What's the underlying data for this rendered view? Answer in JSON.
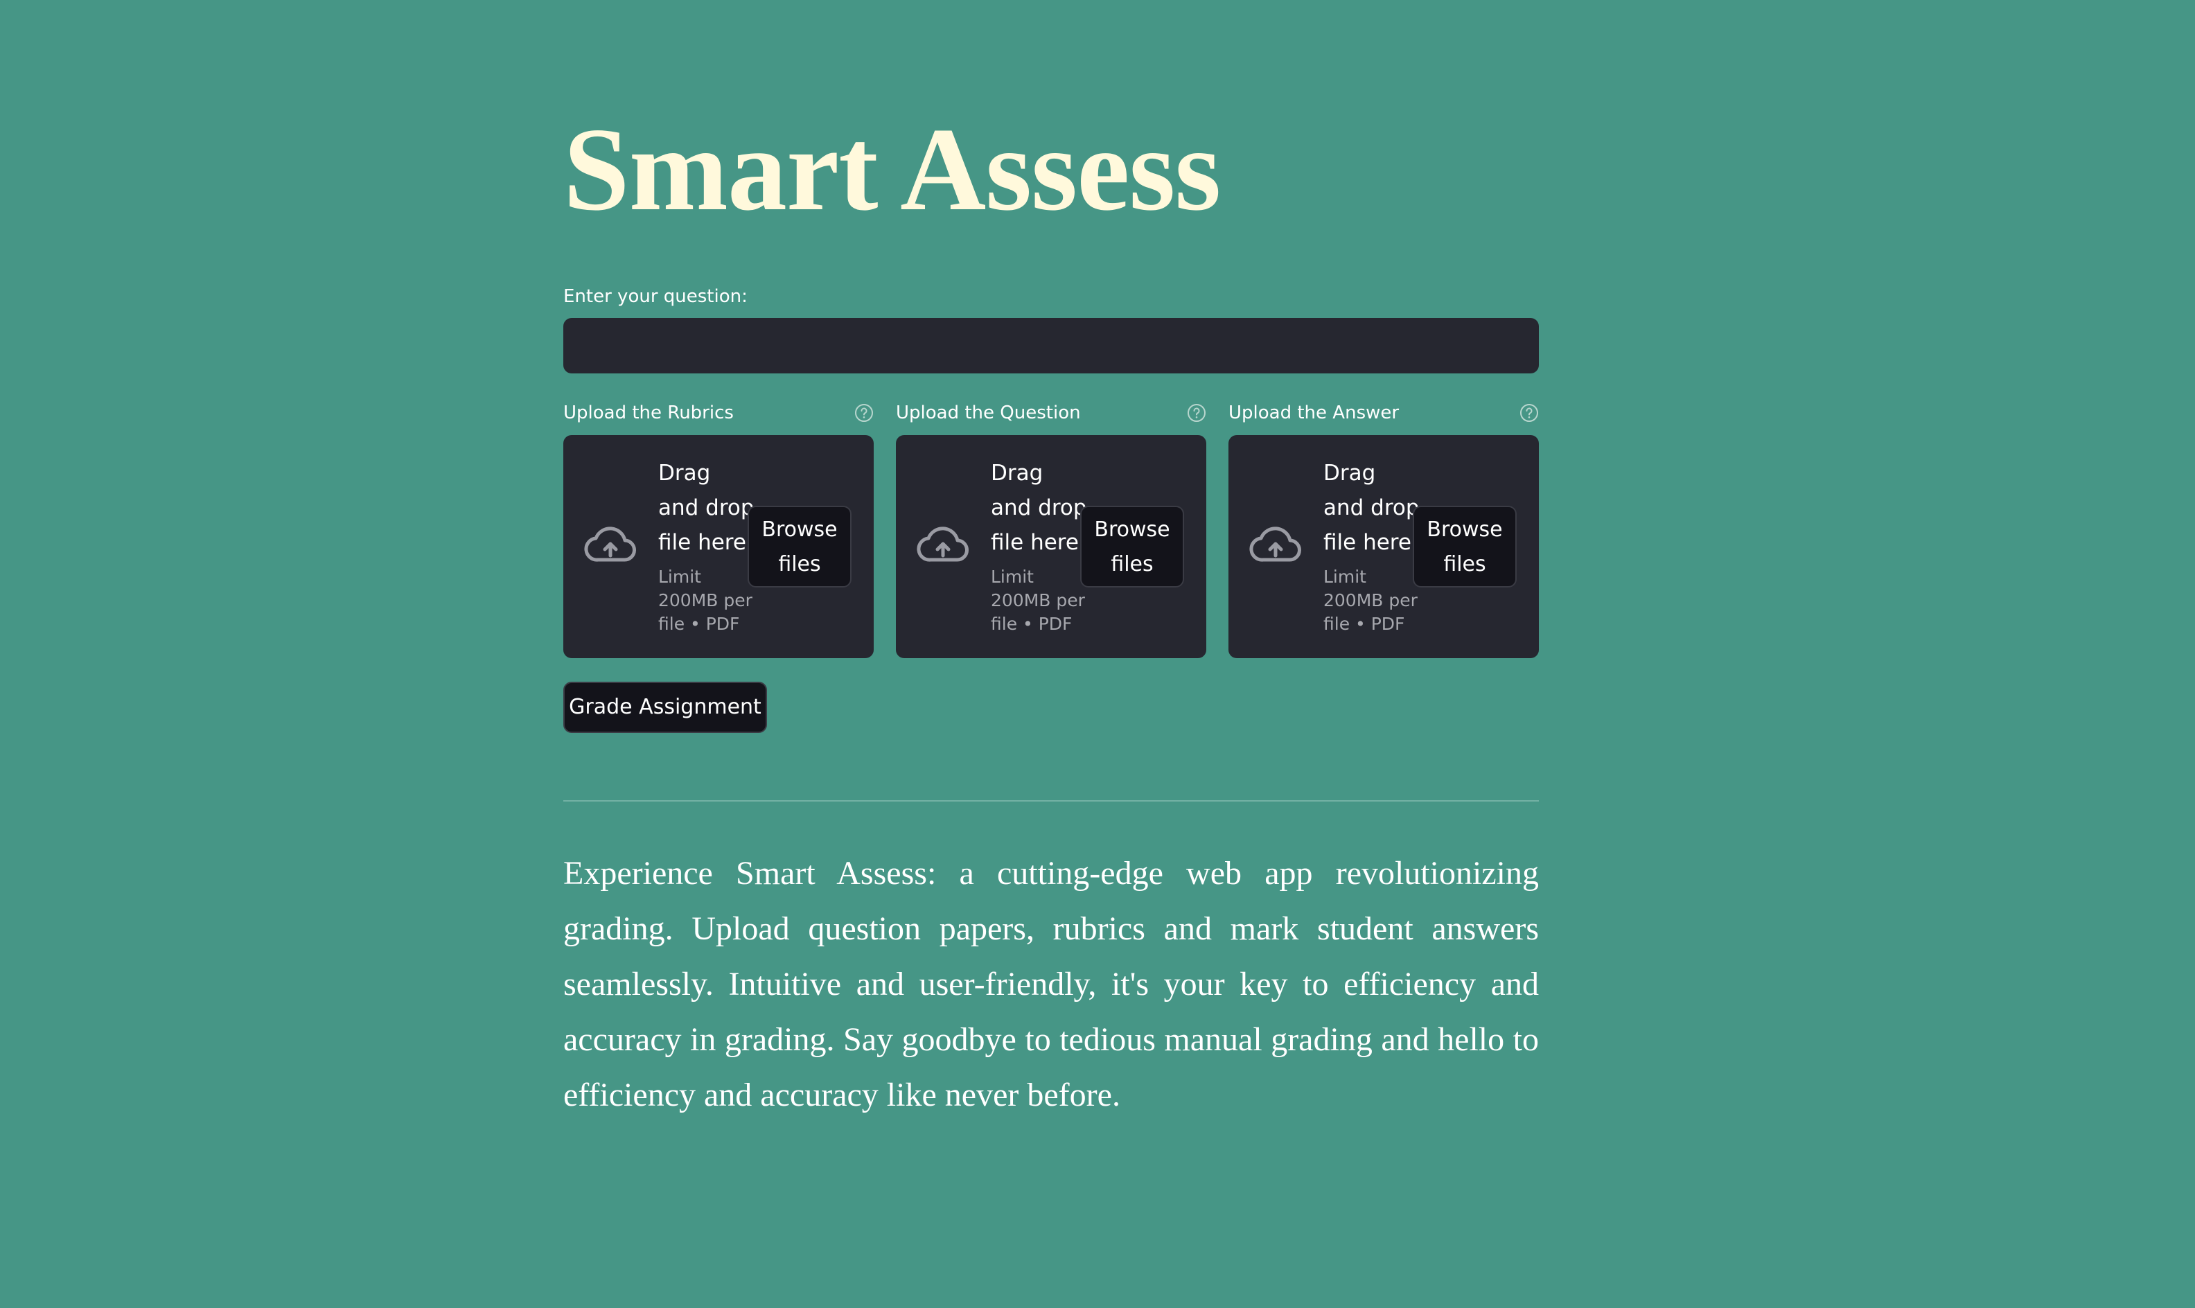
{
  "app": {
    "title": "Smart Assess"
  },
  "question": {
    "label": "Enter your question:",
    "value": "",
    "placeholder": ""
  },
  "uploaders": [
    {
      "label": "Upload the Rubrics",
      "drop_text": "Drag and drop file here",
      "limit_text": "Limit 200MB per file • PDF",
      "browse_label": "Browse files",
      "icon": "cloud-upload-icon",
      "help_icon": "help-circle-icon"
    },
    {
      "label": "Upload the Question",
      "drop_text": "Drag and drop file here",
      "limit_text": "Limit 200MB per file • PDF",
      "browse_label": "Browse files",
      "icon": "cloud-upload-icon",
      "help_icon": "help-circle-icon"
    },
    {
      "label": "Upload the Answer",
      "drop_text": "Drag and drop file here",
      "limit_text": "Limit 200MB per file • PDF",
      "browse_label": "Browse files",
      "icon": "cloud-upload-icon",
      "help_icon": "help-circle-icon"
    }
  ],
  "actions": {
    "grade_label": "Grade Assignment"
  },
  "description": "Experience Smart Assess: a cutting-edge web app revolutionizing grading. Upload question papers, rubrics and mark student answers seamlessly. Intuitive and user-friendly, it's your key to efficiency and accuracy in grading. Say goodbye to tedious manual grading and hello to efficiency and accuracy like never before.",
  "colors": {
    "background": "#469686",
    "title": "#FFF9DC",
    "panel": "#262730",
    "button": "#13131A",
    "muted_text": "#A7A8AE"
  }
}
